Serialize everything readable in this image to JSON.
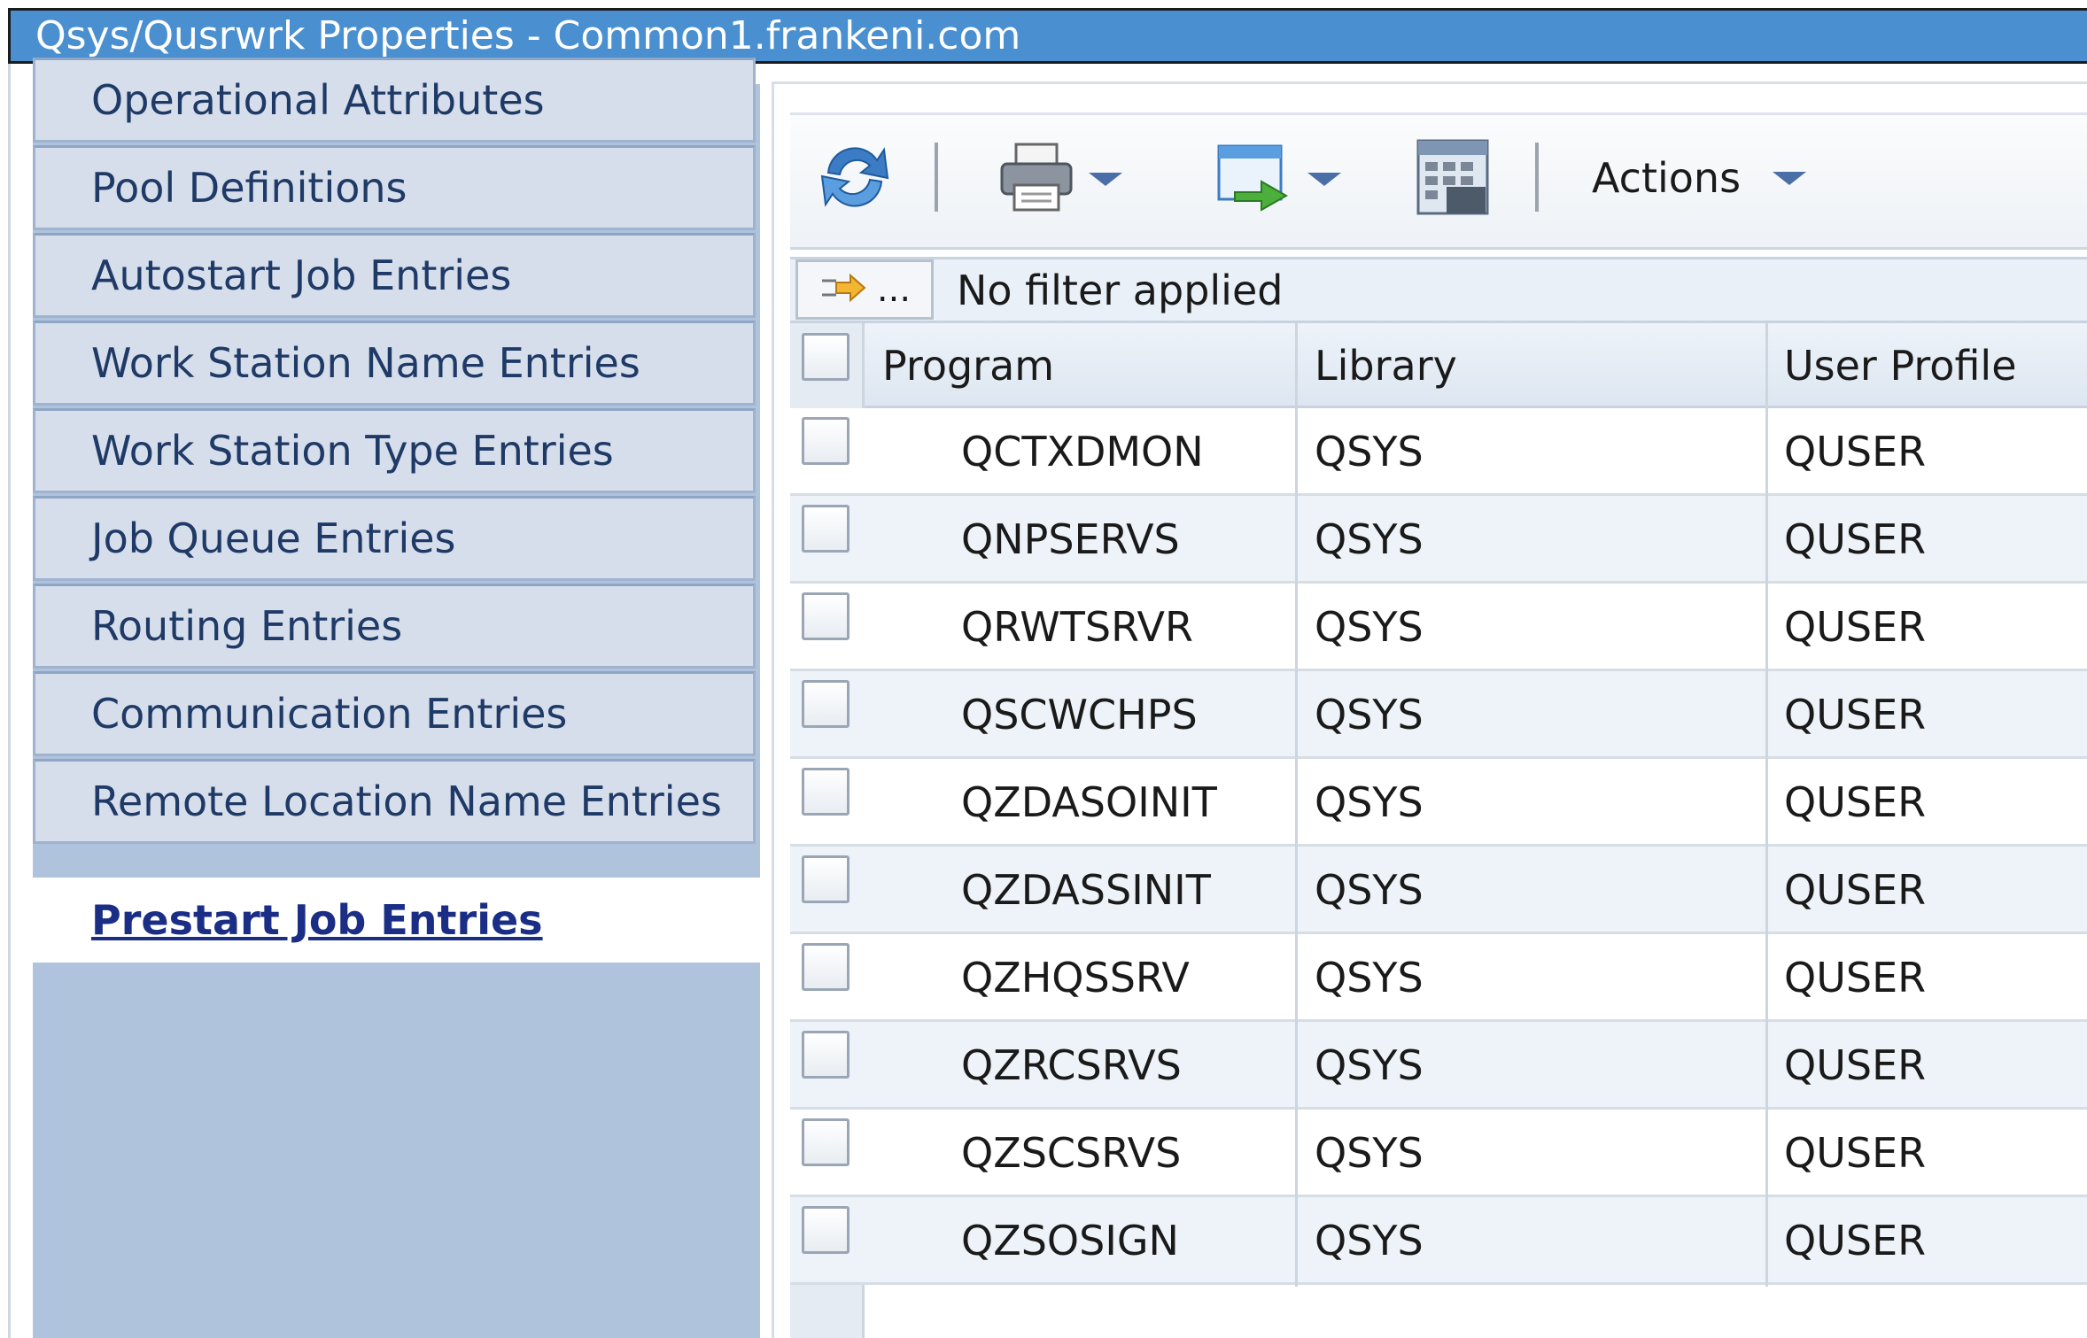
{
  "window": {
    "title": "Qsys/Qusrwrk Properties - Common1.frankeni.com"
  },
  "sidebar": {
    "items": [
      {
        "label": "Operational Attributes"
      },
      {
        "label": "Pool Definitions"
      },
      {
        "label": "Autostart Job Entries"
      },
      {
        "label": "Work Station Name Entries"
      },
      {
        "label": "Work Station Type Entries"
      },
      {
        "label": "Job Queue Entries"
      },
      {
        "label": "Routing Entries"
      },
      {
        "label": "Communication Entries"
      },
      {
        "label": "Remote Location Name Entries"
      },
      {
        "label": "Prestart Job Entries",
        "active": true
      }
    ]
  },
  "toolbar": {
    "icons": [
      "refresh-icon",
      "print-icon",
      "export-icon",
      "calculator-icon"
    ],
    "actions_label": "Actions"
  },
  "filter": {
    "button_label": "...",
    "text": "No filter applied"
  },
  "table": {
    "columns": [
      "Program",
      "Library",
      "User Profile"
    ],
    "rows": [
      [
        "QCTXDMON",
        "QSYS",
        "QUSER"
      ],
      [
        "QNPSERVS",
        "QSYS",
        "QUSER"
      ],
      [
        "QRWTSRVR",
        "QSYS",
        "QUSER"
      ],
      [
        "QSCWCHPS",
        "QSYS",
        "QUSER"
      ],
      [
        "QZDASOINIT",
        "QSYS",
        "QUSER"
      ],
      [
        "QZDASSINIT",
        "QSYS",
        "QUSER"
      ],
      [
        "QZHQSSRV",
        "QSYS",
        "QUSER"
      ],
      [
        "QZRCSRVS",
        "QSYS",
        "QUSER"
      ],
      [
        "QZSCSRVS",
        "QSYS",
        "QUSER"
      ],
      [
        "QZSOSIGN",
        "QSYS",
        "QUSER"
      ]
    ]
  },
  "colors": {
    "titlebar": "#4a90d0",
    "sidebar": "#afc3dc",
    "active_link": "#1b2e86"
  }
}
